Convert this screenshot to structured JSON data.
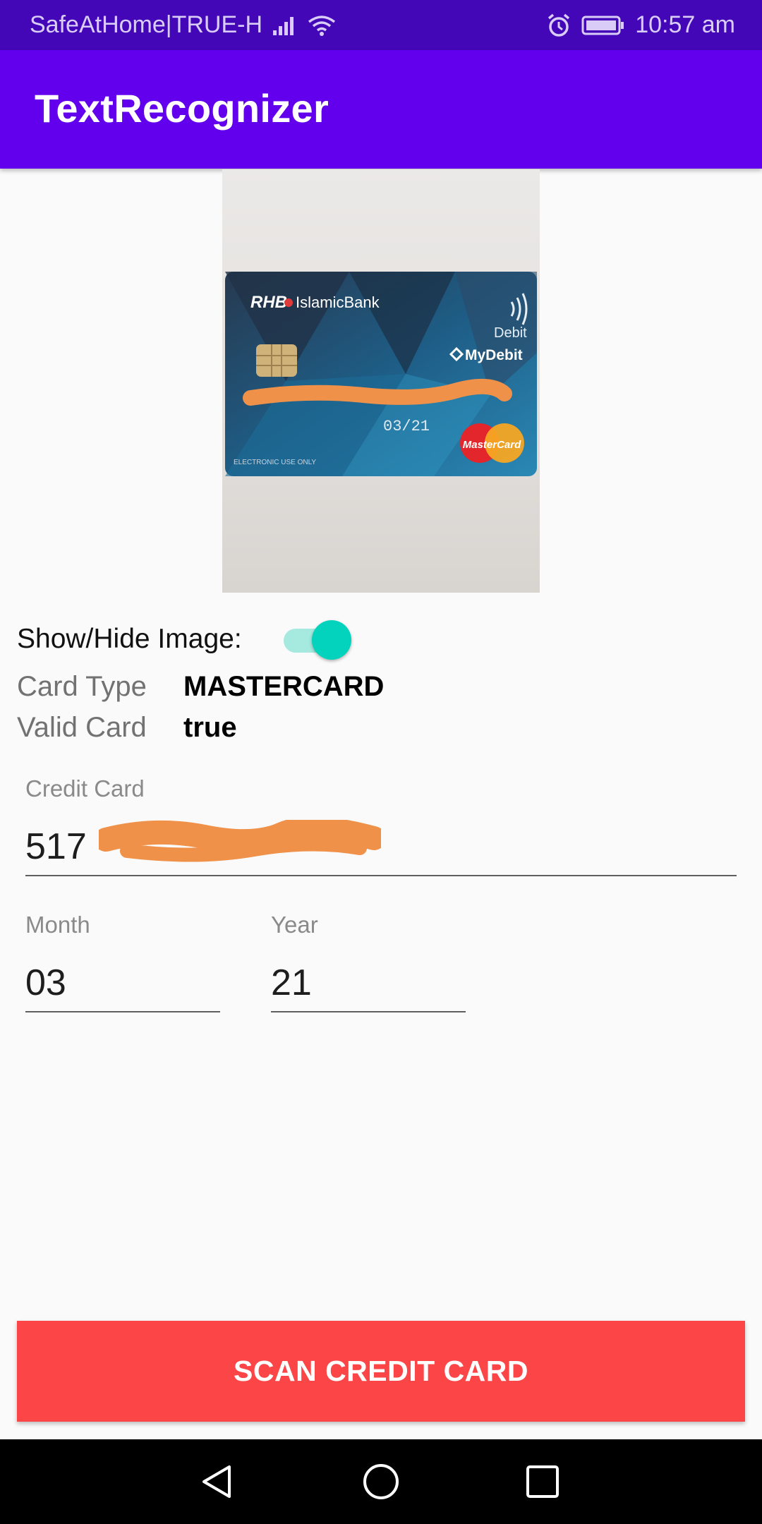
{
  "status_bar": {
    "carrier": "SafeAtHome|TRUE-H",
    "time": "10:57 am",
    "icons": [
      "signal-icon",
      "wifi-icon",
      "alarm-icon",
      "battery-icon"
    ]
  },
  "app_bar": {
    "title": "TextRecognizer"
  },
  "card_image": {
    "bank_name": "IslamicBank",
    "bank_logo": "RHB",
    "debit_label": "Debit",
    "mydebit_label": "MyDebit",
    "expiry": "03/21",
    "footer": "ELECTRONIC USE ONLY",
    "network_logo": "MasterCard"
  },
  "toggle": {
    "label": "Show/Hide Image:",
    "checked": true
  },
  "info": {
    "card_type_label": "Card Type",
    "card_type_value": "MASTERCARD",
    "valid_label": "Valid Card",
    "valid_value": "true"
  },
  "fields": {
    "credit_card_label": "Credit Card",
    "credit_card_value": "517",
    "month_label": "Month",
    "month_value": "03",
    "year_label": "Year",
    "year_value": "21"
  },
  "scan_button": {
    "label": "SCAN CREDIT CARD"
  },
  "colors": {
    "status_bar": "#4407b8",
    "app_bar": "#6200ee",
    "switch_thumb": "#03d3bd",
    "switch_track": "#a5e9df",
    "scan_button": "#fb4546",
    "redaction": "#f0914a"
  }
}
